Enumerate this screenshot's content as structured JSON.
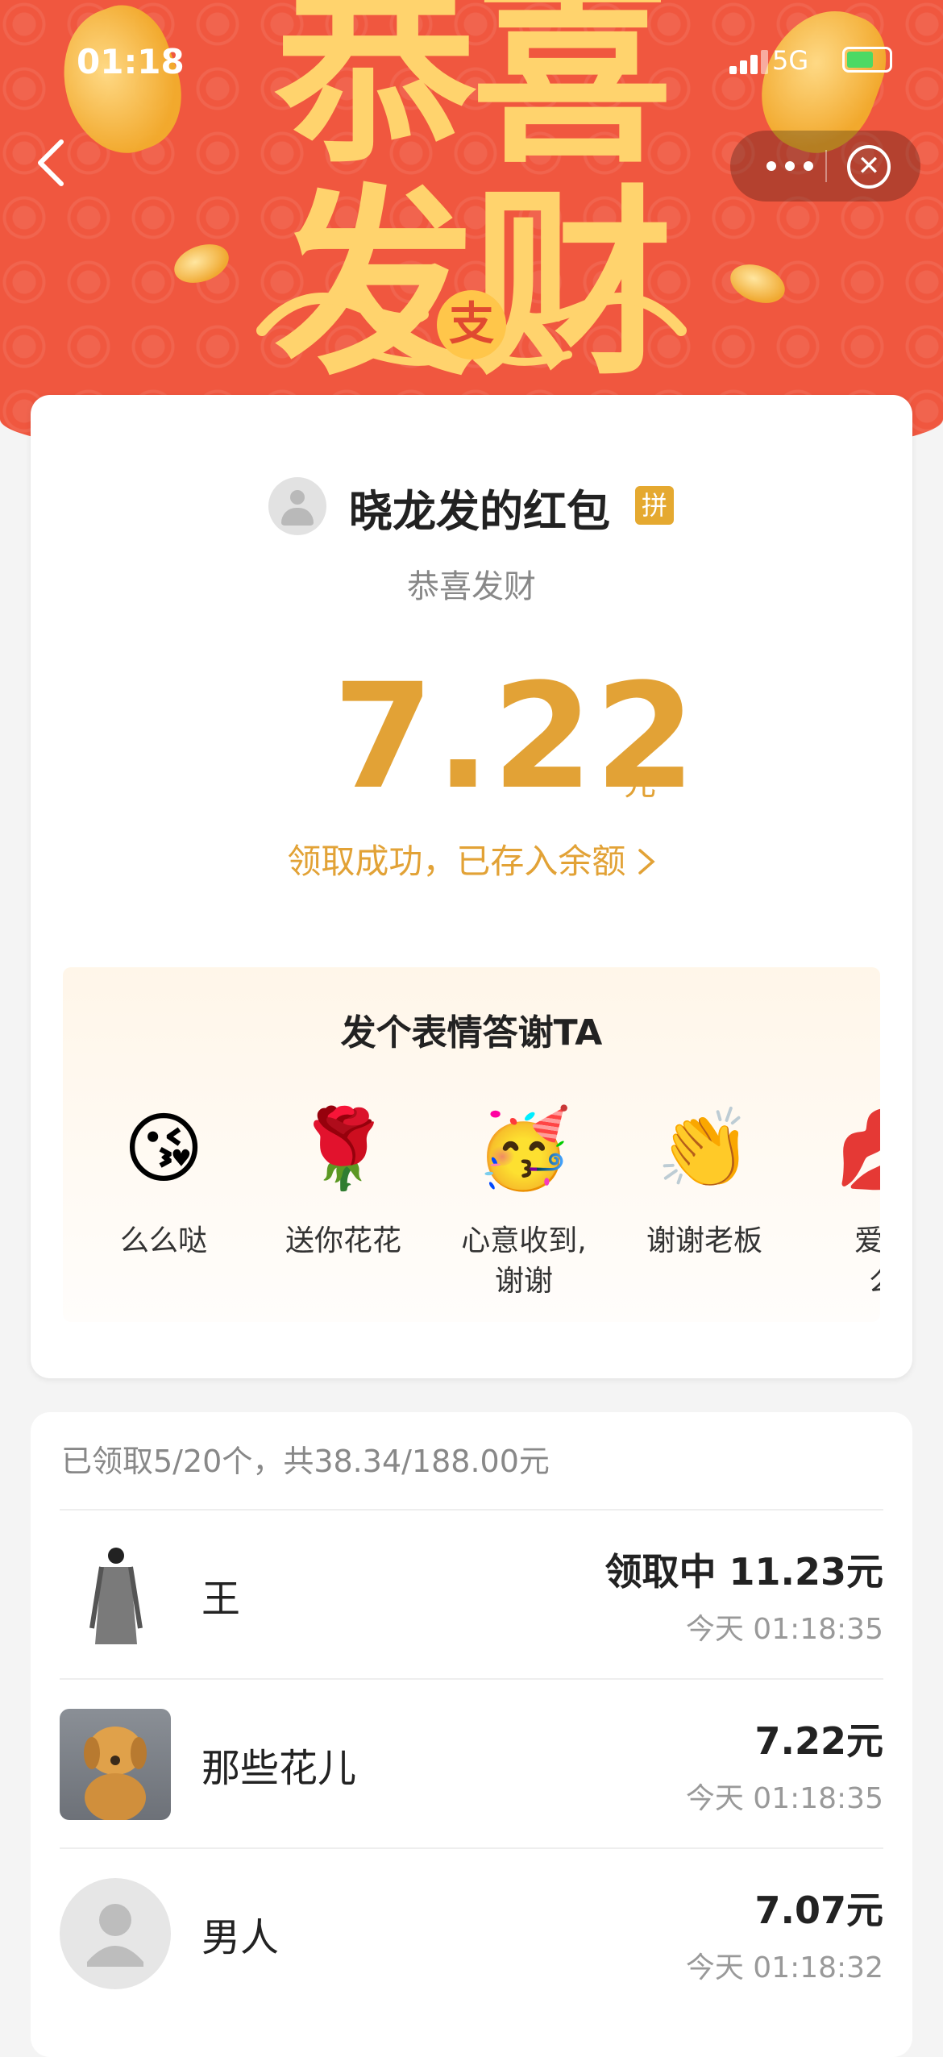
{
  "status_bar": {
    "time": "01:18",
    "network": "5G"
  },
  "header": {
    "big_title": "恭喜\n发财"
  },
  "nav": {
    "back_icon": "chevron-left-icon",
    "more_icon": "more-dots-icon",
    "close_icon": "close-circle-icon"
  },
  "packet": {
    "sender_title": "晓龙发的红包",
    "badge": "拼",
    "blessing": "恭喜发财",
    "amount": "7.22",
    "unit": "元",
    "claim_message": "领取成功，已存入余额"
  },
  "thanks": {
    "title": "发个表情答谢TA",
    "items": [
      {
        "emoji": "😘",
        "label": "么么哒"
      },
      {
        "emoji": "🌹",
        "label": "送你花花"
      },
      {
        "emoji": "🥳",
        "label": "心意收到,\n谢谢"
      },
      {
        "emoji": "👏",
        "label": "谢谢老板"
      },
      {
        "emoji": "💋",
        "label": "爱你\n么"
      }
    ]
  },
  "claims": {
    "summary": "已领取5/20个，共38.34/188.00元",
    "rows": [
      {
        "name": "王",
        "amount": "领取中 11.23元",
        "time": "今天 01:18:35"
      },
      {
        "name": "那些花儿",
        "amount": "7.22元",
        "time": "今天 01:18:35"
      },
      {
        "name": "男人",
        "amount": "7.07元",
        "time": "今天 01:18:32"
      }
    ]
  },
  "colors": {
    "header_red": "#f0573f",
    "gold": "#e2a236",
    "badge": "#e5a930"
  }
}
